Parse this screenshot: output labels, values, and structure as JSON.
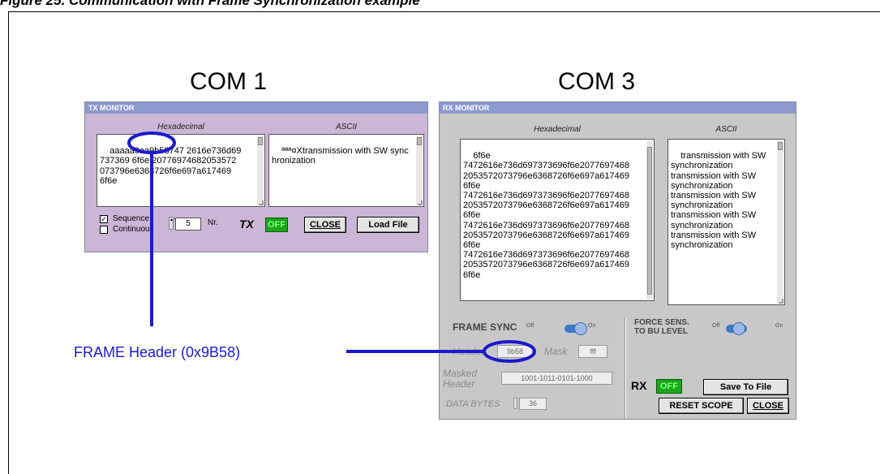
{
  "figure_caption": "Figure 25.   Communication with Frame Synchronization example",
  "com1_label": "COM 1",
  "com3_label": "COM 3",
  "annotation": "FRAME Header (0x9B58)",
  "tx": {
    "title": "TX MONITOR",
    "hex_header": "Hexadecimal",
    "ascii_header": "ASCII",
    "hex_text": "aaaaa9aa9b58747 2616e736d69\n737369 6f6e 20776974682053572\n073796e6368726f6e697a617469\n6f6e",
    "ascii_text": "ªªª¤Xtransmission with SW sync\nhronization",
    "sequence_label": "Sequence",
    "continuous_label": "Continuous",
    "sequence_checked": true,
    "continuous_checked": false,
    "repeat_value": "5",
    "nr_label": "Nr.",
    "tx_label": "TX",
    "status": "OFF",
    "close_label": "CLOSE",
    "load_label": "Load File"
  },
  "rx": {
    "title": "RX MONITOR",
    "hex_header": "Hexadecimal",
    "ascii_header": "ASCII",
    "hex_text": "6f6e\n7472616e736d697373696f6e2077697468\n2053572073796e6368726f6e697a617469\n6f6e\n7472616e736d697373696f6e2077697468\n2053572073796e6368726f6e697a617469\n6f6e\n7472616e736d697373696f6e2077697468\n2053572073796e6368726f6e697a617469\n6f6e\n7472616e736d697373696f6e2077697468\n2053572073796e6368726f6e697a617469\n6f6e",
    "ascii_text": "transmission with SW\nsynchronization\ntransmission with SW\nsynchronization\ntransmission with SW\nsynchronization\ntransmission with SW\nsynchronization\ntransmission with SW\nsynchronization",
    "frame_sync_label": "FRAME SYNC",
    "off_label": "Off",
    "on_label": "On",
    "force_sens_label": "FORCE SENS.\nTO BU LEVEL",
    "header_label": "Header",
    "header_value": "9b58",
    "mask_label": "Mask",
    "mask_value": "fff",
    "masked_header_label": "Masked\nHeader",
    "masked_header_value": "1001-1011-0101-1000",
    "data_bytes_label": "DATA BYTES",
    "data_bytes_value": "36",
    "rx_label": "RX",
    "status": "OFF",
    "save_label": "Save To File",
    "reset_label": "RESET SCOPE",
    "close_label": "CLOSE"
  },
  "colors": {
    "window_bg_tx": "#cbb6d6",
    "window_bg_rx": "#c8c8c8",
    "titlebar": "#8c9ad0",
    "callout": "#1a1acc",
    "led_green": "#1aa51a"
  }
}
